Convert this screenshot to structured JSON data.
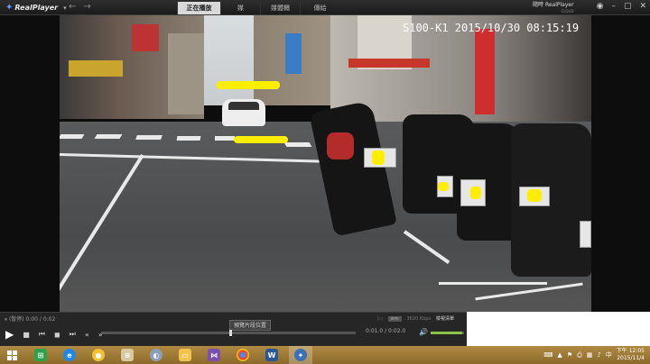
{
  "app": {
    "logo_text": "RealPlayer",
    "brand_line1": "RealPlayer",
    "brand_line2": "CLOUD",
    "brand_prefix": "隨時",
    "nav_back": "←",
    "nav_forward": "→"
  },
  "tabs": [
    {
      "label": "正在播放",
      "active": true
    },
    {
      "label": "媒",
      "active": false
    },
    {
      "label": "媒體櫃",
      "active": false
    },
    {
      "label": "傳給",
      "active": false
    }
  ],
  "video": {
    "osd_text": "S100-K1 2015/10/30 08:15:19"
  },
  "controls": {
    "info_text": "(暫停) 0:00 / 0:02",
    "tooltip": "預覽片段位置",
    "res_label": "wm",
    "bitrate_label": "3620 Kbps",
    "compress_label": "檢視清單",
    "time_text": "0:01.0 / 0:02.0",
    "volume_percent": 95
  },
  "taskbar": {
    "clock_time": "下午 12:05",
    "clock_date": "2015/11/4",
    "ime": "中"
  }
}
